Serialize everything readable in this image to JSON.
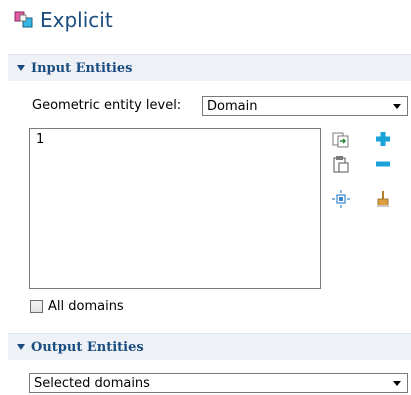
{
  "title": "Explicit",
  "sections": {
    "input": {
      "label": "Input Entities"
    },
    "output": {
      "label": "Output Entities"
    }
  },
  "geometric_level": {
    "label": "Geometric entity level:",
    "value": "Domain"
  },
  "selection_list": {
    "items": [
      "1"
    ]
  },
  "all_domains": {
    "label": "All domains",
    "checked": false
  },
  "output_select": {
    "value": "Selected domains"
  },
  "colors": {
    "title": "#1a4c80",
    "plus": "#1aa3d9",
    "minus": "#1aa3d9",
    "header_bg": "#eef1f6"
  }
}
